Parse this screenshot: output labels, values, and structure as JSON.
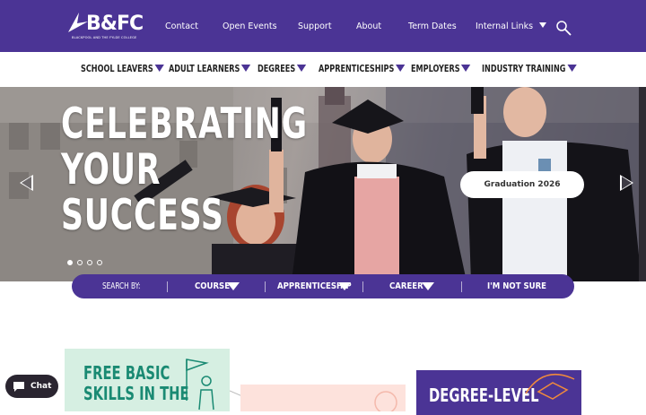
{
  "brand": {
    "logo_text": "B&FC",
    "logo_subtext": "BLACKPOOL AND THE FYLDE COLLEGE",
    "primary_color": "#4b3495"
  },
  "topnav": {
    "links": [
      "Contact",
      "Open Events",
      "Support",
      "About",
      "Term Dates",
      "Internal Links"
    ],
    "search_icon": "search-icon"
  },
  "mainnav": {
    "items": [
      "SCHOOL LEAVERS",
      "ADULT LEARNERS",
      "DEGREES",
      "APPRENTICESHIPS",
      "EMPLOYERS",
      "INDUSTRY TRAINING"
    ]
  },
  "hero": {
    "title_lines": [
      "CELEBRATING",
      "YOUR",
      "SUCCESS"
    ],
    "button_label": "Graduation 2026",
    "slide_count": 4,
    "active_slide": 1
  },
  "searchbar": {
    "label": "SEARCH BY:",
    "options": [
      "COURSE",
      "APPRENTICESHIP",
      "CAREER",
      "I'M NOT SURE"
    ]
  },
  "cards": {
    "green_lines": [
      "FREE BASIC",
      "SKILLS IN THE"
    ],
    "purple_title": "DEGREE-LEVEL"
  },
  "chat": {
    "label": "Chat"
  }
}
